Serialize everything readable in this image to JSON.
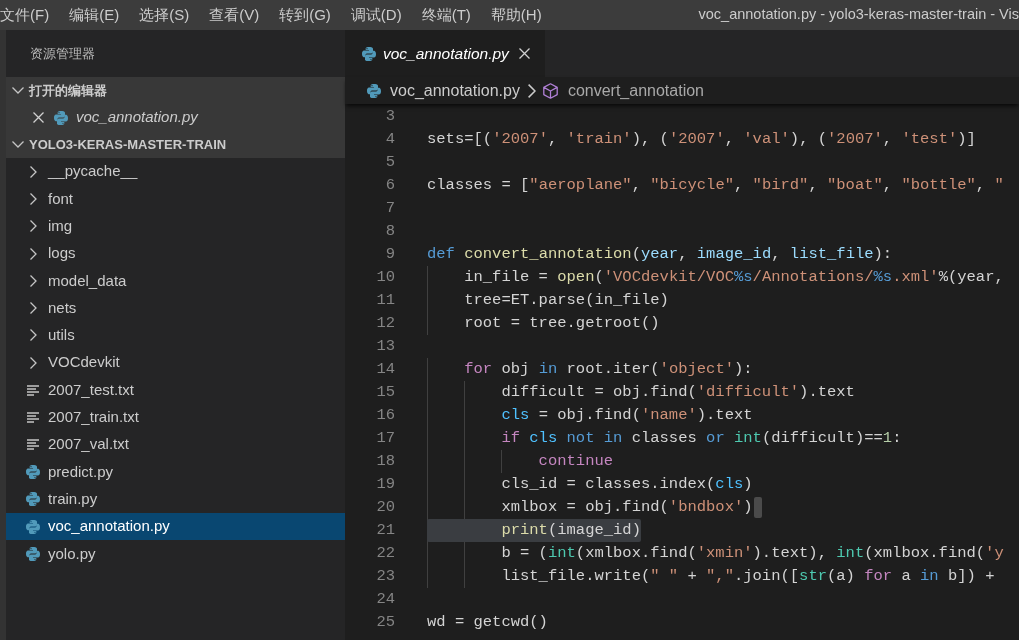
{
  "menu_bar": {
    "items": [
      "文件(F)",
      "编辑(E)",
      "选择(S)",
      "查看(V)",
      "转到(G)",
      "调试(D)",
      "终端(T)",
      "帮助(H)"
    ],
    "window_title": "voc_annotation.py - yolo3-keras-master-train - Vis"
  },
  "sidebar": {
    "title": "资源管理器",
    "sections": [
      {
        "title": "打开的编辑器",
        "kind": "open-editors",
        "expanded": true,
        "items": [
          {
            "label": "voc_annotation.py",
            "kind": "python-file",
            "preview": true
          }
        ]
      },
      {
        "title": "YOLO3-KERAS-MASTER-TRAIN",
        "kind": "folder",
        "expanded": true,
        "items": [
          {
            "label": "__pycache__",
            "kind": "folder",
            "expanded": false,
            "selected": false
          },
          {
            "label": "font",
            "kind": "folder",
            "expanded": false,
            "selected": false
          },
          {
            "label": "img",
            "kind": "folder",
            "expanded": false,
            "selected": false
          },
          {
            "label": "logs",
            "kind": "folder",
            "expanded": false,
            "selected": false
          },
          {
            "label": "model_data",
            "kind": "folder",
            "expanded": false,
            "selected": false
          },
          {
            "label": "nets",
            "kind": "folder",
            "expanded": false,
            "selected": false
          },
          {
            "label": "utils",
            "kind": "folder",
            "expanded": false,
            "selected": false
          },
          {
            "label": "VOCdevkit",
            "kind": "folder",
            "expanded": false,
            "selected": false
          },
          {
            "label": "2007_test.txt",
            "kind": "text-file",
            "selected": false
          },
          {
            "label": "2007_train.txt",
            "kind": "text-file",
            "selected": false
          },
          {
            "label": "2007_val.txt",
            "kind": "text-file",
            "selected": false
          },
          {
            "label": "predict.py",
            "kind": "python-file",
            "selected": false
          },
          {
            "label": "train.py",
            "kind": "python-file",
            "selected": false
          },
          {
            "label": "voc_annotation.py",
            "kind": "python-file",
            "selected": true
          },
          {
            "label": "yolo.py",
            "kind": "python-file",
            "selected": false
          }
        ]
      }
    ]
  },
  "editor": {
    "tabs": [
      {
        "label": "voc_annotation.py",
        "kind": "python-file",
        "selected": true,
        "preview": true
      }
    ],
    "breadcrumb": [
      {
        "label": "voc_annotation.py",
        "kind": "python-file"
      },
      {
        "label": "convert_annotation",
        "kind": "symbol"
      }
    ],
    "lines": [
      {
        "number": "3",
        "selected": false,
        "cursor": false
      },
      {
        "number": "4",
        "selected": false,
        "cursor": false,
        "tokens": [
          {
            "text": "sets=[(",
            "kind": "plain"
          },
          {
            "text": "'2007'",
            "kind": "string"
          },
          {
            "text": ", ",
            "kind": "plain"
          },
          {
            "text": "'train'",
            "kind": "string"
          },
          {
            "text": "), (",
            "kind": "plain"
          },
          {
            "text": "'2007'",
            "kind": "string"
          },
          {
            "text": ", ",
            "kind": "plain"
          },
          {
            "text": "'val'",
            "kind": "string"
          },
          {
            "text": "), (",
            "kind": "plain"
          },
          {
            "text": "'2007'",
            "kind": "string"
          },
          {
            "text": ", ",
            "kind": "plain"
          },
          {
            "text": "'test'",
            "kind": "string"
          },
          {
            "text": ")]",
            "kind": "plain"
          }
        ]
      },
      {
        "number": "5",
        "selected": false,
        "cursor": false
      },
      {
        "number": "6",
        "selected": false,
        "cursor": false,
        "tokens": [
          {
            "text": "classes = [",
            "kind": "plain"
          },
          {
            "text": "\"aeroplane\"",
            "kind": "string"
          },
          {
            "text": ", ",
            "kind": "plain"
          },
          {
            "text": "\"bicycle\"",
            "kind": "string"
          },
          {
            "text": ", ",
            "kind": "plain"
          },
          {
            "text": "\"bird\"",
            "kind": "string"
          },
          {
            "text": ", ",
            "kind": "plain"
          },
          {
            "text": "\"boat\"",
            "kind": "string"
          },
          {
            "text": ", ",
            "kind": "plain"
          },
          {
            "text": "\"bottle\"",
            "kind": "string"
          },
          {
            "text": ", ",
            "kind": "plain"
          },
          {
            "text": "\"",
            "kind": "string"
          }
        ]
      },
      {
        "number": "7",
        "selected": false,
        "cursor": false
      },
      {
        "number": "8",
        "selected": false,
        "cursor": false
      },
      {
        "number": "9",
        "selected": false,
        "cursor": false,
        "tokens": [
          {
            "text": "def ",
            "kind": "keyword"
          },
          {
            "text": "convert_annotation",
            "kind": "function"
          },
          {
            "text": "(",
            "kind": "plain"
          },
          {
            "text": "year",
            "kind": "parameter"
          },
          {
            "text": ", ",
            "kind": "plain"
          },
          {
            "text": "image_id",
            "kind": "parameter"
          },
          {
            "text": ", ",
            "kind": "plain"
          },
          {
            "text": "list_file",
            "kind": "parameter"
          },
          {
            "text": "):",
            "kind": "plain"
          }
        ]
      },
      {
        "number": "10",
        "selected": false,
        "cursor": false,
        "tokens": [
          {
            "text": "    in_file = ",
            "kind": "plain"
          },
          {
            "text": "open",
            "kind": "function"
          },
          {
            "text": "(",
            "kind": "plain"
          },
          {
            "text": "'VOCdevkit/VOC",
            "kind": "string"
          },
          {
            "text": "%s",
            "kind": "format"
          },
          {
            "text": "/Annotations/",
            "kind": "string"
          },
          {
            "text": "%s",
            "kind": "format"
          },
          {
            "text": ".xml'",
            "kind": "string"
          },
          {
            "text": "%(year,",
            "kind": "plain"
          }
        ]
      },
      {
        "number": "11",
        "selected": false,
        "cursor": false,
        "tokens": [
          {
            "text": "    tree=ET.parse(in_file)",
            "kind": "plain"
          }
        ]
      },
      {
        "number": "12",
        "selected": false,
        "cursor": false,
        "tokens": [
          {
            "text": "    root = tree.getroot()",
            "kind": "plain"
          }
        ]
      },
      {
        "number": "13",
        "selected": false,
        "cursor": false
      },
      {
        "number": "14",
        "selected": false,
        "cursor": false,
        "tokens": [
          {
            "text": "    for",
            "kind": "control"
          },
          {
            "text": " obj ",
            "kind": "plain"
          },
          {
            "text": "in",
            "kind": "keyword"
          },
          {
            "text": " root.iter(",
            "kind": "plain"
          },
          {
            "text": "'object'",
            "kind": "string"
          },
          {
            "text": "):",
            "kind": "plain"
          }
        ]
      },
      {
        "number": "15",
        "selected": false,
        "cursor": false,
        "tokens": [
          {
            "text": "        difficult = obj.find(",
            "kind": "plain"
          },
          {
            "text": "'difficult'",
            "kind": "string"
          },
          {
            "text": ").text",
            "kind": "plain"
          }
        ]
      },
      {
        "number": "16",
        "selected": false,
        "cursor": false,
        "tokens": [
          {
            "text": "        cls",
            "kind": "variable"
          },
          {
            "text": " = obj.find(",
            "kind": "plain"
          },
          {
            "text": "'name'",
            "kind": "string"
          },
          {
            "text": ").text",
            "kind": "plain"
          }
        ]
      },
      {
        "number": "17",
        "selected": false,
        "cursor": false,
        "tokens": [
          {
            "text": "        if",
            "kind": "control"
          },
          {
            "text": " cls",
            "kind": "variable"
          },
          {
            "text": " not in",
            "kind": "keyword"
          },
          {
            "text": " classes ",
            "kind": "plain"
          },
          {
            "text": "or",
            "kind": "keyword"
          },
          {
            "text": " int",
            "kind": "builtin"
          },
          {
            "text": "(difficult)==",
            "kind": "plain"
          },
          {
            "text": "1",
            "kind": "number"
          },
          {
            "text": ":",
            "kind": "plain"
          }
        ]
      },
      {
        "number": "18",
        "selected": false,
        "cursor": false,
        "tokens": [
          {
            "text": "            continue",
            "kind": "control"
          }
        ]
      },
      {
        "number": "19",
        "selected": false,
        "cursor": false,
        "tokens": [
          {
            "text": "        cls_id = classes.index(",
            "kind": "plain"
          },
          {
            "text": "cls",
            "kind": "variable"
          },
          {
            "text": ")",
            "kind": "plain"
          }
        ]
      },
      {
        "number": "20",
        "selected": false,
        "cursor": true,
        "tokens": [
          {
            "text": "        xmlbox = obj.find(",
            "kind": "plain"
          },
          {
            "text": "'bndbox'",
            "kind": "string"
          },
          {
            "text": ")",
            "kind": "plain"
          }
        ]
      },
      {
        "number": "21",
        "selected": true,
        "cursor": false,
        "tokens": [
          {
            "text": "        print",
            "kind": "function"
          },
          {
            "text": "(image_id)",
            "kind": "plain"
          }
        ]
      },
      {
        "number": "22",
        "selected": false,
        "cursor": false,
        "tokens": [
          {
            "text": "        b = (",
            "kind": "plain"
          },
          {
            "text": "int",
            "kind": "builtin"
          },
          {
            "text": "(xmlbox.find(",
            "kind": "plain"
          },
          {
            "text": "'xmin'",
            "kind": "string"
          },
          {
            "text": ").text), ",
            "kind": "plain"
          },
          {
            "text": "int",
            "kind": "builtin"
          },
          {
            "text": "(xmlbox.find(",
            "kind": "plain"
          },
          {
            "text": "'y",
            "kind": "string"
          }
        ]
      },
      {
        "number": "23",
        "selected": false,
        "cursor": false,
        "tokens": [
          {
            "text": "        list_file.write(",
            "kind": "plain"
          },
          {
            "text": "\" \"",
            "kind": "string"
          },
          {
            "text": " + ",
            "kind": "plain"
          },
          {
            "text": "\",\"",
            "kind": "string"
          },
          {
            "text": ".join([",
            "kind": "plain"
          },
          {
            "text": "str",
            "kind": "builtin"
          },
          {
            "text": "(a) ",
            "kind": "plain"
          },
          {
            "text": "for",
            "kind": "control"
          },
          {
            "text": " a ",
            "kind": "plain"
          },
          {
            "text": "in",
            "kind": "keyword"
          },
          {
            "text": " b]) +",
            "kind": "plain"
          }
        ]
      },
      {
        "number": "24",
        "selected": false,
        "cursor": false
      },
      {
        "number": "25",
        "selected": false,
        "cursor": false,
        "tokens": [
          {
            "text": "wd = getcwd()",
            "kind": "plain"
          }
        ]
      }
    ]
  }
}
